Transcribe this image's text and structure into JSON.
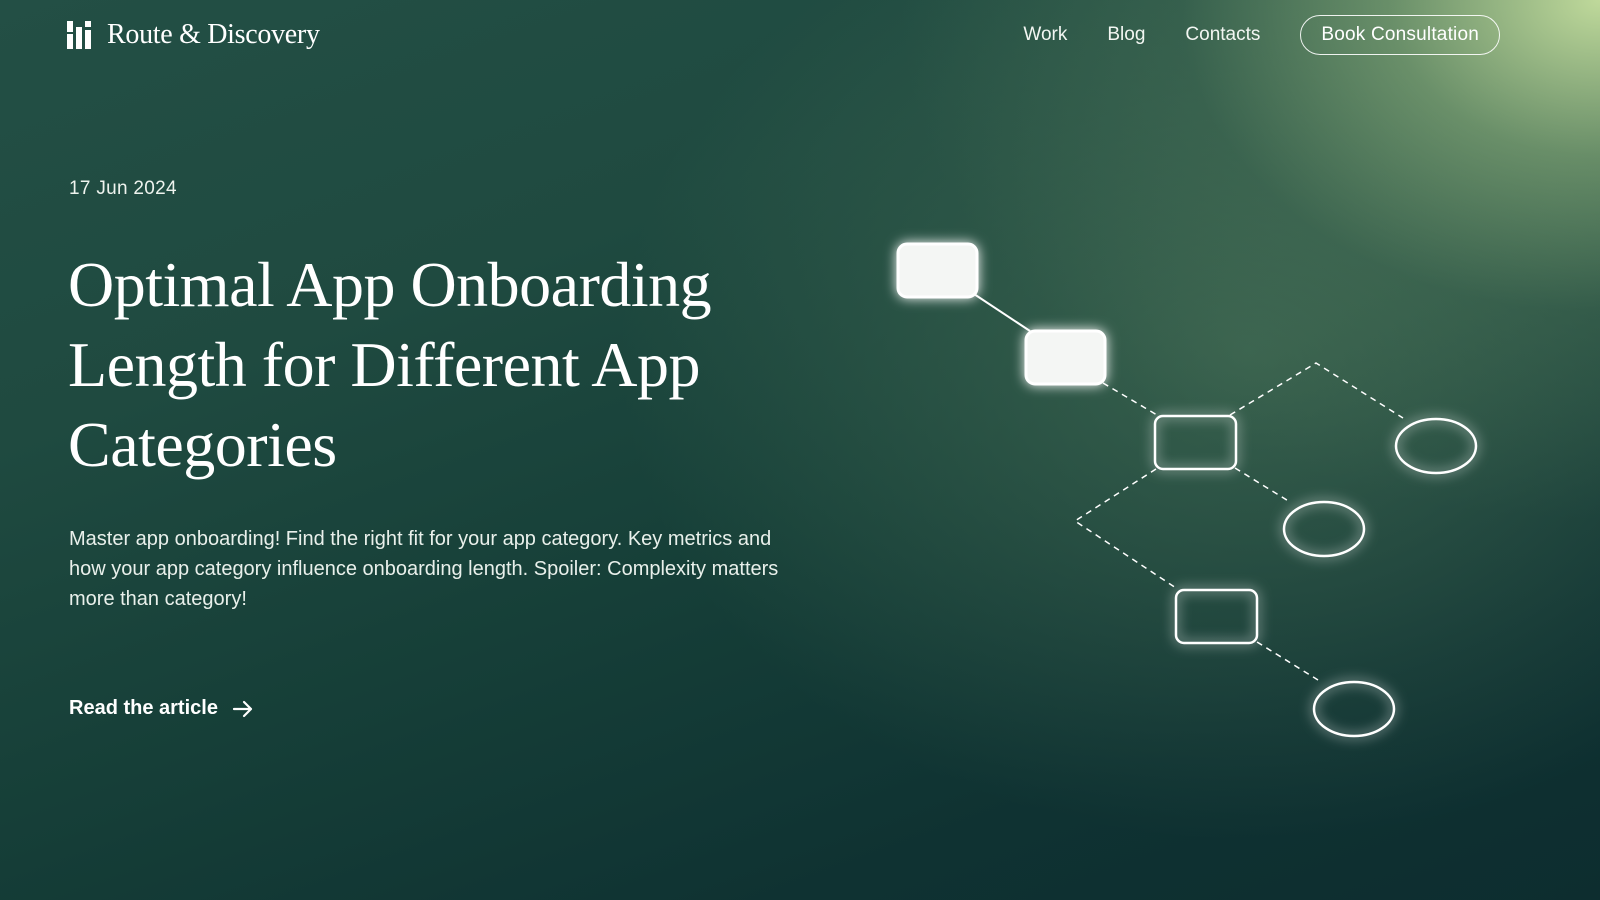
{
  "brand": {
    "name": "Route & Discovery",
    "logo_icon": "bars-logo-icon"
  },
  "nav": {
    "items": [
      "Work",
      "Blog",
      "Contacts"
    ],
    "cta_label": "Book Consultation"
  },
  "post": {
    "date": "17 Jun 2024",
    "title": "Optimal App Onboarding Length for Different App Categories",
    "excerpt": "Master app onboarding! Find the right fit for your app category. Key metrics and how your app category influence onboarding length. Spoiler: Complexity matters more than category!",
    "read_label": "Read the article",
    "read_icon": "arrow-right-icon"
  },
  "diagram": {
    "name": "flow-diagram",
    "node_count": 8,
    "filled_nodes": 2
  },
  "colors": {
    "background_dark": "#0d2d2f",
    "background_mid": "#1f4a40",
    "glow": "#c8e1a0",
    "text": "#ffffff",
    "node_fill": "#f4f6f4"
  }
}
